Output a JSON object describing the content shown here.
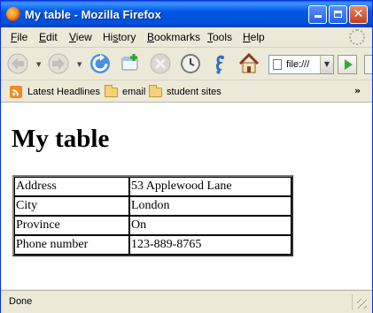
{
  "window": {
    "title": "My table - Mozilla Firefox",
    "controls": {
      "minimize": "minimize",
      "maximize": "maximize",
      "close": "✕"
    }
  },
  "menu": {
    "items": [
      {
        "label": "File",
        "accel": "F",
        "rest": "ile"
      },
      {
        "label": "Edit",
        "accel": "E",
        "rest": "dit"
      },
      {
        "label": "View",
        "accel": "V",
        "rest": "iew"
      },
      {
        "label": "History",
        "accel": "s",
        "pre": "Hi",
        "rest": "tory"
      },
      {
        "label": "Bookmarks",
        "accel": "B",
        "rest": "ookmarks"
      },
      {
        "label": "Tools",
        "accel": "T",
        "rest": "ools"
      },
      {
        "label": "Help",
        "accel": "H",
        "rest": "elp"
      }
    ]
  },
  "toolbar": {
    "icons": [
      "back-arrow-icon",
      "forward-arrow-icon",
      "reload-icon",
      "new-tab-icon",
      "stop-icon",
      "history-clock-icon",
      "seahorse-icon",
      "home-icon"
    ],
    "address": {
      "value": "file:///"
    }
  },
  "bookmarks": {
    "items": [
      {
        "label": "Latest Headlines",
        "icon": "rss-icon"
      },
      {
        "label": "email",
        "icon": "folder-icon"
      },
      {
        "label": "student sites",
        "icon": "folder-icon"
      }
    ],
    "overflow": "»"
  },
  "page": {
    "heading": "My table",
    "table": [
      [
        "Address",
        "53 Applewood Lane"
      ],
      [
        "City",
        "London"
      ],
      [
        "Province",
        "On"
      ],
      [
        "Phone number",
        "123-889-8765"
      ]
    ]
  },
  "status": {
    "text": "Done"
  },
  "colors": {
    "titlebar": "#0058e6",
    "chrome": "#ece9d8",
    "close_button": "#c3401c"
  }
}
